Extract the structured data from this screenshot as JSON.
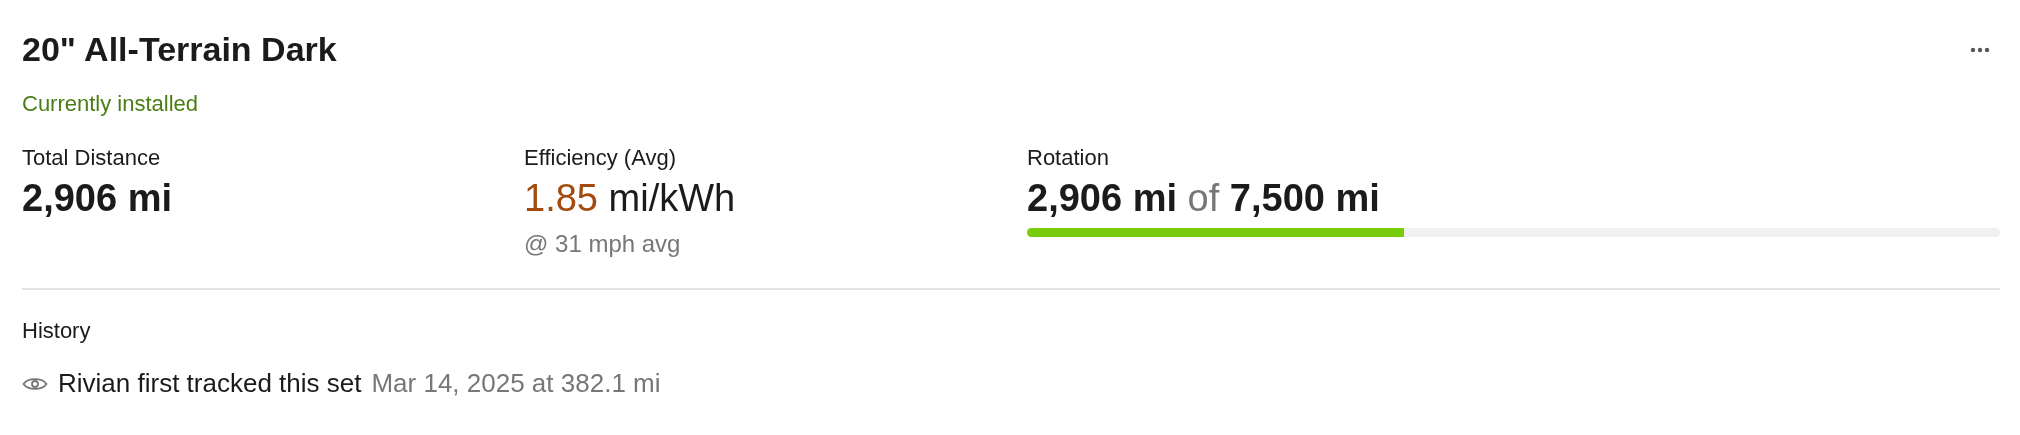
{
  "title": "20\" All-Terrain Dark",
  "status": "Currently installed",
  "stats": [
    {
      "kind": "plain",
      "label": "Total Distance",
      "value": "2,906 mi"
    },
    {
      "kind": "efficiency",
      "label": "Efficiency (Avg)",
      "value": "1.85",
      "unit": "mi/kWh",
      "note": "@ 31 mph avg"
    },
    {
      "kind": "progress",
      "label": "Rotation",
      "value": "2,906 mi",
      "separator": "of",
      "total": "7,500 mi",
      "level": 0.387
    }
  ],
  "history": {
    "heading": "History",
    "events": [
      {
        "text": "Rivian first tracked this set",
        "meta": "Mar 14, 2025 at 382.1 mi"
      }
    ]
  }
}
